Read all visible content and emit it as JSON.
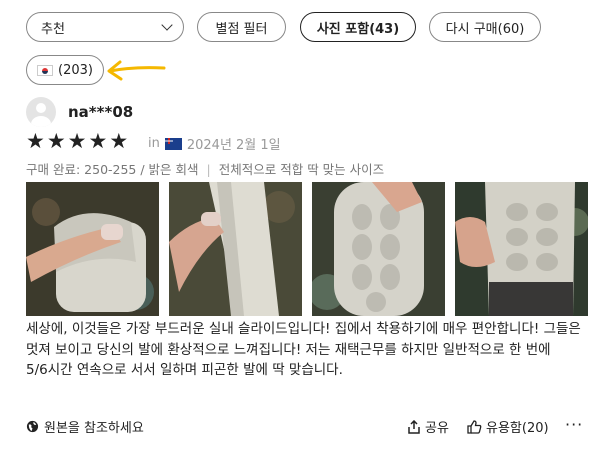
{
  "filters": {
    "sort_label": "추천",
    "stars_label": "별점 필터",
    "photos_label": "사진 포함(43)",
    "repurchase_label": "다시 구매(60)",
    "country_count": "(203)"
  },
  "review": {
    "username": "na***08",
    "rating": 5,
    "stars": "★★★★★",
    "in_label": "in",
    "date": "2024년 2월 1일",
    "purchase_info": "구매 완료: 250-255 / 밝은 회색",
    "fit": "전체적으로 적합 딱 맞는 사이즈",
    "text": "세상에, 이것들은 가장 부드러운 실내 슬라이드입니다! 집에서 착용하기에 매우 편안합니다! 그들은 멋져 보이고 당신의 발에 환상적으로 느껴집니다! 저는 재택근무를 하지만 일반적으로 한 번에 5/6시간 연속으로 서서 일하며 피곤한 발에 딱 맞습니다."
  },
  "footer": {
    "original_label": "원본을 참조하세요",
    "share_label": "공유",
    "helpful_label": "유용함(20)",
    "more_label": "···"
  },
  "colors": {
    "accent_arrow": "#f5b800",
    "text": "#222222",
    "muted": "#999999"
  },
  "icons": [
    "chevron-down-icon",
    "korea-flag-icon",
    "arrow-annotation-icon",
    "user-avatar-icon",
    "star-icon",
    "australia-flag-icon",
    "globe-icon",
    "share-icon",
    "thumbs-up-icon",
    "more-icon"
  ]
}
